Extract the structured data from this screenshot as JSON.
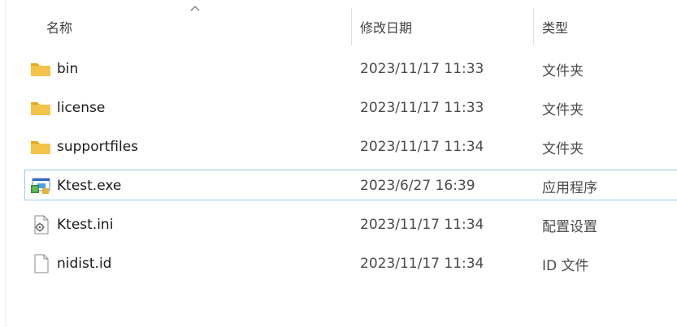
{
  "columns": {
    "name": "名称",
    "date": "修改日期",
    "type": "类型"
  },
  "sort": {
    "column": "name",
    "direction": "ascending",
    "icon": "chevron-up-icon"
  },
  "colors": {
    "folder": "#f3c34a",
    "folder_dark": "#e6a817",
    "selection_border": "#99c9ef"
  },
  "files": [
    {
      "name": "bin",
      "date": "2023/11/17 11:33",
      "type": "文件夹",
      "icon": "folder-icon"
    },
    {
      "name": "license",
      "date": "2023/11/17 11:33",
      "type": "文件夹",
      "icon": "folder-icon"
    },
    {
      "name": "supportfiles",
      "date": "2023/11/17 11:34",
      "type": "文件夹",
      "icon": "folder-icon"
    },
    {
      "name": "Ktest.exe",
      "date": "2023/6/27 16:39",
      "type": "应用程序",
      "icon": "application-icon",
      "selected": true
    },
    {
      "name": "Ktest.ini",
      "date": "2023/11/17 11:34",
      "type": "配置设置",
      "icon": "settings-file-icon"
    },
    {
      "name": "nidist.id",
      "date": "2023/11/17 11:34",
      "type": "ID 文件",
      "icon": "file-icon"
    }
  ]
}
